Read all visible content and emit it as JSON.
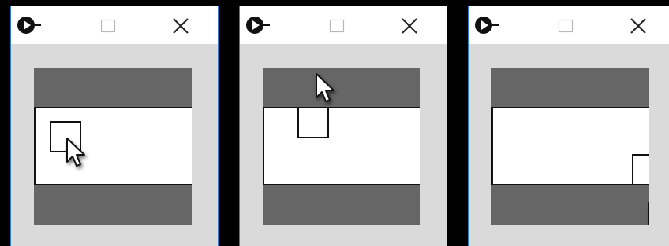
{
  "windows": [
    {
      "id": "window-1",
      "square_state": "inside-band",
      "cursor_on": "square"
    },
    {
      "id": "window-2",
      "square_state": "top-edge",
      "cursor_on": "top-dark-band"
    },
    {
      "id": "window-3",
      "square_state": "bottom-right-edge",
      "cursor_on": "bottom-right-corner"
    }
  ],
  "icons": {
    "app": "app-logo-icon",
    "maximize": "maximize-icon",
    "close": "close-icon",
    "cursor": "mouse-pointer-icon"
  },
  "colors": {
    "titlebar": "#ffffff",
    "client_bg": "#dadada",
    "dark_band": "#666666",
    "light_band": "#ffffff",
    "border": "#2b7bd3",
    "outline": "#111111"
  }
}
